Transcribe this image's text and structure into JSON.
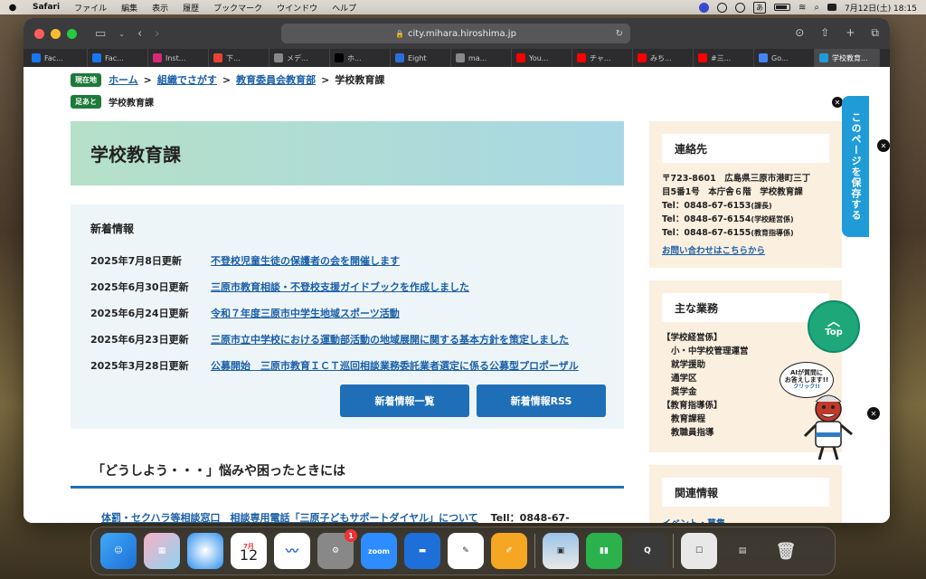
{
  "menubar": {
    "app": "Safari",
    "items": [
      "ファイル",
      "編集",
      "表示",
      "履歴",
      "ブックマーク",
      "ウインドウ",
      "ヘルプ"
    ],
    "input_mode": "あ",
    "date_time": "7月12日(土)  18:15"
  },
  "browser": {
    "url": "city.mihara.hiroshima.jp",
    "tabs": [
      {
        "label": "Fac...",
        "color": "#1877f2"
      },
      {
        "label": "Fac...",
        "color": "#1877f2"
      },
      {
        "label": "Inst...",
        "color": "#d62976"
      },
      {
        "label": "下...",
        "color": "#ea4335"
      },
      {
        "label": "メデ...",
        "color": "#888888"
      },
      {
        "label": "ホ...",
        "color": "#000000"
      },
      {
        "label": "Eight",
        "color": "#2c6fdb"
      },
      {
        "label": "ma...",
        "color": "#888888"
      },
      {
        "label": "You...",
        "color": "#ff0000"
      },
      {
        "label": "チャ...",
        "color": "#ff0000"
      },
      {
        "label": "みち...",
        "color": "#ff0000"
      },
      {
        "label": "#三...",
        "color": "#ff0000"
      },
      {
        "label": "Go...",
        "color": "#4285f4"
      },
      {
        "label": "学校教育...",
        "color": "#1f9cd8",
        "active": true
      }
    ]
  },
  "breadcrumb": {
    "tag": "現在地",
    "home": "ホーム",
    "level1": "組織でさがす",
    "level2": "教育委員会教育部",
    "current": "学校教育課",
    "sep": ">"
  },
  "footprint": {
    "tag": "足あと",
    "item": "学校教育課"
  },
  "page_title": "学校教育課",
  "news": {
    "heading": "新着情報",
    "items": [
      {
        "date": "2025年7月8日更新",
        "title": "不登校児童生徒の保護者の会を開催します"
      },
      {
        "date": "2025年6月30日更新",
        "title": "三原市教育相談・不登校支援ガイドブックを作成しました"
      },
      {
        "date": "2025年6月24日更新",
        "title": "令和７年度三原市中学生地域スポーツ活動"
      },
      {
        "date": "2025年6月23日更新",
        "title": "三原市立中学校における運動部活動の地域展開に関する基本方針を策定しました"
      },
      {
        "date": "2025年3月28日更新",
        "title": "公募開始　三原市教育ＩＣＴ巡回相談業務委託業者選定に係る公募型プロポーザル"
      }
    ],
    "btn_list": "新着情報一覧",
    "btn_rss": "新着情報RSS"
  },
  "trouble": {
    "heading": "「どうしよう・・・」悩みや困ったときには",
    "link": "体罰・セクハラ等相談窓口　相談専用電話「三原子どもサポートダイヤル」について",
    "tel": "Tell：0848-67-"
  },
  "contact": {
    "heading": "連絡先",
    "address1": "〒723-8601　広島県三原市港町三丁",
    "address2": "目5番1号　本庁舎６階　学校教育課",
    "tel1": "Tel：0848-67-6153",
    "tel1_note": "(課長)",
    "tel2": "Tel：0848-67-6154",
    "tel2_note": "(学校経営係)",
    "tel3": "Tel：0848-67-6155",
    "tel3_note": "(教育指導係)",
    "inquiry": "お問い合わせはこちらから"
  },
  "duties": {
    "heading": "主な業務",
    "lines": [
      {
        "text": "【学校経営係】",
        "indent": false
      },
      {
        "text": "小・中学校管理運営",
        "indent": true
      },
      {
        "text": "就学援助",
        "indent": true
      },
      {
        "text": "通学区",
        "indent": true
      },
      {
        "text": "奨学金",
        "indent": true
      },
      {
        "text": "【教育指導係】",
        "indent": false
      },
      {
        "text": "教育課程",
        "indent": true
      },
      {
        "text": "教職員指導",
        "indent": true
      }
    ]
  },
  "related": {
    "heading": "関連情報",
    "partial": "イベント・募集"
  },
  "floating": {
    "save": "このページを保存する",
    "top": "Top",
    "ai_line1": "AIが質問に",
    "ai_line2": "お答えします!!",
    "ai_click": "クリック!!"
  },
  "dock": {
    "calendar_month": "7月",
    "calendar_day": "12",
    "zoom": "zoom",
    "badge": "1"
  }
}
